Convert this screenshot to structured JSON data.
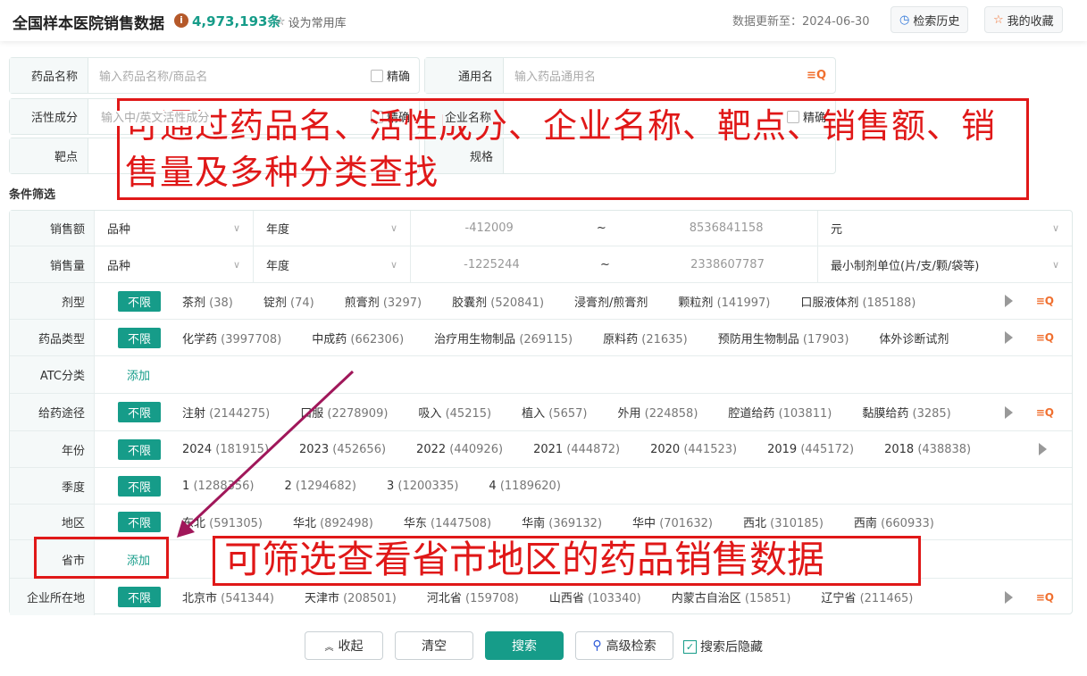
{
  "header": {
    "title": "全国样本医院销售数据",
    "info_icon": "i",
    "count": "4,973,193条",
    "set_common": "设为常用库",
    "updated": "数据更新至：2024-06-30",
    "history": "检索历史",
    "favorites": "我的收藏"
  },
  "search": {
    "drug_name": {
      "label": "药品名称",
      "placeholder": "输入药品名称/商品名",
      "exact": "精确"
    },
    "generic": {
      "label": "通用名",
      "placeholder": "输入药品通用名"
    },
    "ingredient": {
      "label": "活性成分",
      "placeholder": "输入中/英文活性成分",
      "exact": "精确"
    },
    "company": {
      "label": "企业名称",
      "exact": "精确"
    },
    "target": {
      "label": "靶点"
    },
    "spec": {
      "label": "规格"
    }
  },
  "conditions_title": "条件筛选",
  "sales_amount": {
    "label": "销售额",
    "dim": "品种",
    "period": "年度",
    "min": "-412009",
    "tilde": "~",
    "max": "8536841158",
    "unit": "元"
  },
  "sales_volume": {
    "label": "销售量",
    "dim": "品种",
    "period": "年度",
    "min": "-1225244",
    "tilde": "~",
    "max": "2338607787",
    "unit": "最小制剂单位(片/支/颗/袋等)"
  },
  "unlimited": "不限",
  "add": "添加",
  "filters": [
    {
      "label": "剂型",
      "options": [
        [
          "茶剂",
          "(38)"
        ],
        [
          "锭剂",
          "(74)"
        ],
        [
          "煎膏剂",
          "(3297)"
        ],
        [
          "胶囊剂",
          "(520841)"
        ],
        [
          "浸膏剂/煎膏剂",
          ""
        ],
        [
          "颗粒剂",
          "(141997)"
        ],
        [
          "口服液体剂",
          "(185188)"
        ]
      ]
    },
    {
      "label": "药品类型",
      "options": [
        [
          "化学药",
          "(3997708)"
        ],
        [
          "中成药",
          "(662306)"
        ],
        [
          "治疗用生物制品",
          "(269115)"
        ],
        [
          "原料药",
          "(21635)"
        ],
        [
          "预防用生物制品",
          "(17903)"
        ],
        [
          "体外诊断试剂",
          ""
        ]
      ]
    },
    {
      "label": "ATC分类",
      "add": true
    },
    {
      "label": "给药途径",
      "options": [
        [
          "注射",
          "(2144275)"
        ],
        [
          "口服",
          "(2278909)"
        ],
        [
          "吸入",
          "(45215)"
        ],
        [
          "植入",
          "(5657)"
        ],
        [
          "外用",
          "(224858)"
        ],
        [
          "腔道给药",
          "(103811)"
        ],
        [
          "黏膜给药",
          "(3285)"
        ]
      ]
    },
    {
      "label": "年份",
      "options": [
        [
          "2024",
          "(181915)"
        ],
        [
          "2023",
          "(452656)"
        ],
        [
          "2022",
          "(440926)"
        ],
        [
          "2021",
          "(444872)"
        ],
        [
          "2020",
          "(441523)"
        ],
        [
          "2019",
          "(445172)"
        ],
        [
          "2018",
          "(438838)"
        ]
      ]
    },
    {
      "label": "季度",
      "options": [
        [
          "1",
          "(1288356)"
        ],
        [
          "2",
          "(1294682)"
        ],
        [
          "3",
          "(1200335)"
        ],
        [
          "4",
          "(1189620)"
        ]
      ]
    },
    {
      "label": "地区",
      "options": [
        [
          "东北",
          "(591305)"
        ],
        [
          "华北",
          "(892498)"
        ],
        [
          "华东",
          "(1447508)"
        ],
        [
          "华南",
          "(369132)"
        ],
        [
          "华中",
          "(701632)"
        ],
        [
          "西北",
          "(310185)"
        ],
        [
          "西南",
          "(660933)"
        ]
      ]
    },
    {
      "label": "省市",
      "add": true
    },
    {
      "label": "企业所在地",
      "options": [
        [
          "北京市",
          "(541344)"
        ],
        [
          "天津市",
          "(208501)"
        ],
        [
          "河北省",
          "(159708)"
        ],
        [
          "山西省",
          "(103340)"
        ],
        [
          "内蒙古自治区",
          "(15851)"
        ],
        [
          "辽宁省",
          "(211465)"
        ]
      ]
    }
  ],
  "actions": {
    "collapse": "收起",
    "clear": "清空",
    "search": "搜索",
    "advanced": "高级检索",
    "hide_after": "搜索后隐藏"
  },
  "annotations": {
    "top": "可通过药品名、活性成分、企业名称、靶点、销售额、销售量及多种分类查找",
    "bottom": "可筛选查看省市地区的药品销售数据"
  },
  "colors": {
    "accent": "#169c89",
    "annotation": "#e01818",
    "arrow": "#a0175a"
  }
}
